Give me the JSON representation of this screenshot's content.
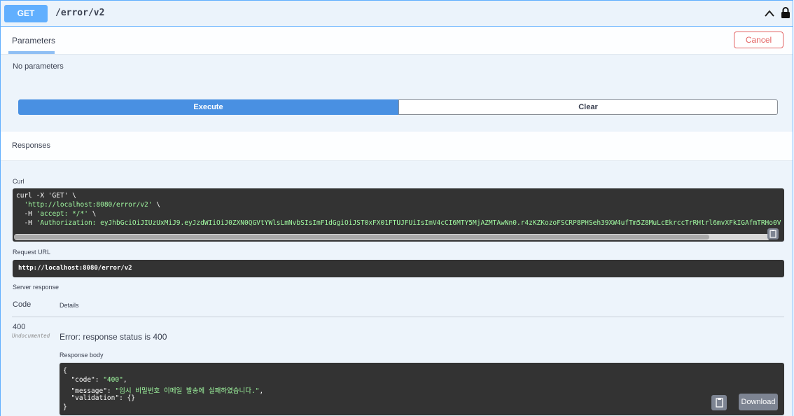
{
  "operation": {
    "method": "GET",
    "path": "/error/v2"
  },
  "parameters": {
    "tab_label": "Parameters",
    "cancel_label": "Cancel",
    "empty_text": "No parameters"
  },
  "actions": {
    "execute_label": "Execute",
    "clear_label": "Clear"
  },
  "responses": {
    "section_label": "Responses",
    "curl_label": "Curl",
    "curl_lines": {
      "l1": "curl -X 'GET' \\",
      "l2_url": "'http://localhost:8080/error/v2'",
      "l2_tail": " \\",
      "l3_prefix": "  -H ",
      "l3_value": "'accept: */*'",
      "l3_tail": " \\",
      "l4_prefix": "  -H ",
      "l4_value": "'Authorization: eyJhbGciOiJIUzUxMiJ9.eyJzdWIiOiJ0ZXN0QGVtYWlsLmNvbSIsImF1dGgiOiJST0xFX01FTUJFUiIsImV4cCI6MTY5MjAZMTAwNn0.r4zKZKozoFSCRP8PHSeh39XW4ufTm5Z8MuLcEkrccTrRHtrl6mvXFkIGAfmTRHo0V"
    },
    "request_url_label": "Request URL",
    "request_url": "http://localhost:8080/error/v2",
    "server_response_label": "Server response",
    "code_header": "Code",
    "details_header": "Details",
    "code": "400",
    "undocumented": "Undocumented",
    "error_text": "Error: response status is 400",
    "response_body_label": "Response body",
    "body": {
      "open": "{",
      "code_key": "  \"code\": ",
      "code_val": "\"400\"",
      "code_tail": ",",
      "message_key": "  \"message\": ",
      "message_val": "\"임시 비밀번호 이메일 발송에 실패하였습니다.\"",
      "message_tail": ",",
      "validation_line": "  \"validation\": {}",
      "close": "}"
    },
    "download_label": "Download"
  },
  "colors": {
    "get_blue": "#61affe",
    "execute_blue": "#4990e2",
    "cancel_red": "#e36464",
    "code_bg": "#333333",
    "string_green": "#a2fca2"
  },
  "icons": [
    "chevron-up-icon",
    "lock-icon",
    "copy-icon"
  ]
}
